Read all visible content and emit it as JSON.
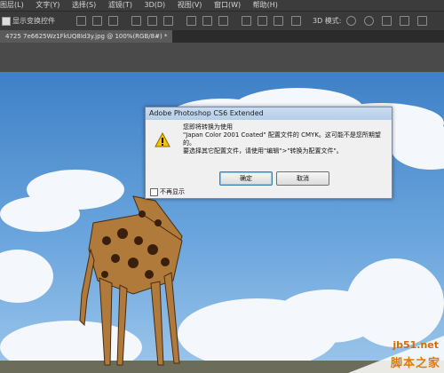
{
  "menu": [
    "图层(L)",
    "文字(Y)",
    "选择(S)",
    "滤镜(T)",
    "3D(D)",
    "视图(V)",
    "窗口(W)",
    "帮助(H)"
  ],
  "options": {
    "show_transform_label": "显示变换控件",
    "mode_label": "3D 模式:"
  },
  "document_tab": {
    "title": "4725 7e6625Wz1FkUQ8Id3y.jpg @ 100%(RGB/8#) *"
  },
  "dialog": {
    "title": "Adobe Photoshop CS6 Extended",
    "lines": [
      "您即将转换为使用",
      "\"Japan Color 2001 Coated\" 配置文件的 CMYK。这可能不是您所期望",
      "的。",
      "要选择其它配置文件，请使用\"编辑\">\"转换为配置文件\"。"
    ],
    "ok_label": "确定",
    "cancel_label": "取消",
    "dont_show_label": "不再显示"
  },
  "watermark": {
    "line1": "jb51.net",
    "line2": "脚本之家"
  },
  "colors": {
    "menubar": "#3c3c3c",
    "sky": "#4a8bcf",
    "dialog_title": "#c9dcf1",
    "warning": "#f4c20d"
  }
}
